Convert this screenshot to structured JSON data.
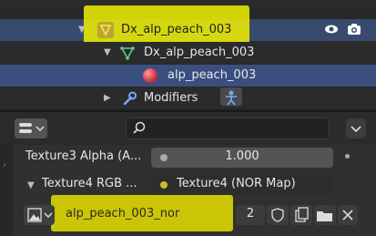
{
  "outliner": {
    "rows": [
      {
        "label": "Dx_alp_peach_003"
      },
      {
        "label": "Dx_alp_peach_003"
      },
      {
        "label": "alp_peach_003"
      },
      {
        "label": "Modifiers"
      }
    ]
  },
  "properties": {
    "search_placeholder": "",
    "texture3": {
      "label": "Texture3 Alpha (A...",
      "value": "1.000"
    },
    "texture4": {
      "label": "Texture4 RGB ...",
      "link": "Texture4 (NOR Map)"
    },
    "image": {
      "name": "alp_peach_003_nor",
      "users": "2"
    }
  },
  "colors": {
    "highlight": "#f1f000",
    "selected_row": "#3a4f80",
    "active_row": "#384a6e",
    "mesh_icon": "#5ad18e",
    "modifier_icon": "#79a7ff",
    "link_dot": "#c7c229"
  }
}
